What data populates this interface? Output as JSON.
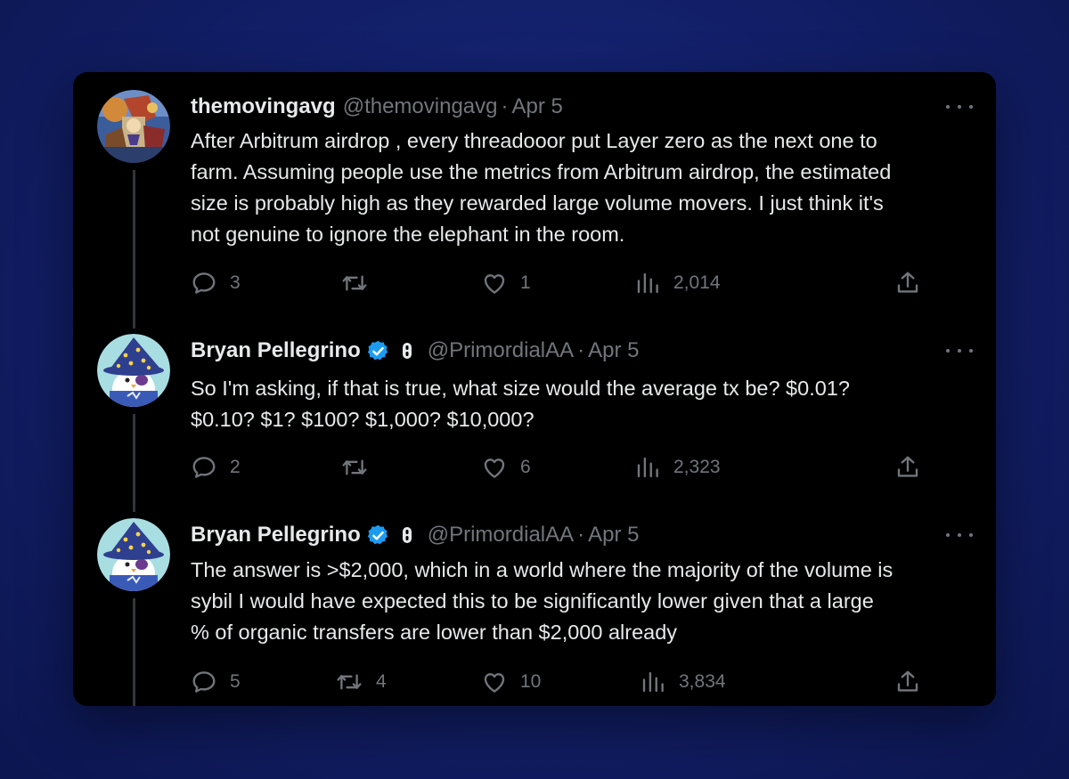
{
  "tweets": [
    {
      "name": "themovingavg",
      "handle": "@themovingavg",
      "separator": "·",
      "date": "Apr 5",
      "verified": false,
      "text_lines": [
        "After Arbitrum airdrop , every threadooor put Layer zero as the next one to",
        "farm. Assuming people use the metrics from Arbitrum airdrop, the estimated",
        "size is probably high as they rewarded large volume movers. I just think it's",
        "not genuine to ignore the elephant in the room."
      ],
      "replies": "3",
      "retweets": "",
      "likes": "1",
      "views": "2,014",
      "avatar_icon": "collage-avatar"
    },
    {
      "name": "Bryan Pellegrino",
      "handle": "@PrimordialAA",
      "separator": "·",
      "date": "Apr 5",
      "verified": true,
      "text_lines": [
        "So I'm asking, if that is true, what size would the average tx be? $0.01?",
        "$0.10? $1? $100? $1,000? $10,000?"
      ],
      "replies": "2",
      "retweets": "",
      "likes": "6",
      "views": "2,323",
      "avatar_icon": "wizard-penguin-avatar"
    },
    {
      "name": "Bryan Pellegrino",
      "handle": "@PrimordialAA",
      "separator": "·",
      "date": "Apr 5",
      "verified": true,
      "text_lines": [
        "The answer is >$2,000, which in a world where the majority of the volume is",
        "sybil I would have expected this to be significantly lower given that a large",
        "% of organic transfers are lower than $2,000 already"
      ],
      "replies": "5",
      "retweets": "4",
      "likes": "10",
      "views": "3,834",
      "avatar_icon": "wizard-penguin-avatar"
    }
  ],
  "icons": {
    "reply": "reply-icon",
    "retweet": "retweet-icon",
    "like": "heart-icon",
    "views": "views-icon",
    "share": "share-icon",
    "more": "more-icon",
    "verified": "verified-badge-icon",
    "affiliation": "affiliation-badge-icon"
  },
  "colors": {
    "background": "#13206b",
    "card": "#000000",
    "primary_text": "#e7e9ea",
    "secondary_text": "#71767b",
    "verified_blue": "#1d9bf0",
    "thread_line": "#333639"
  }
}
